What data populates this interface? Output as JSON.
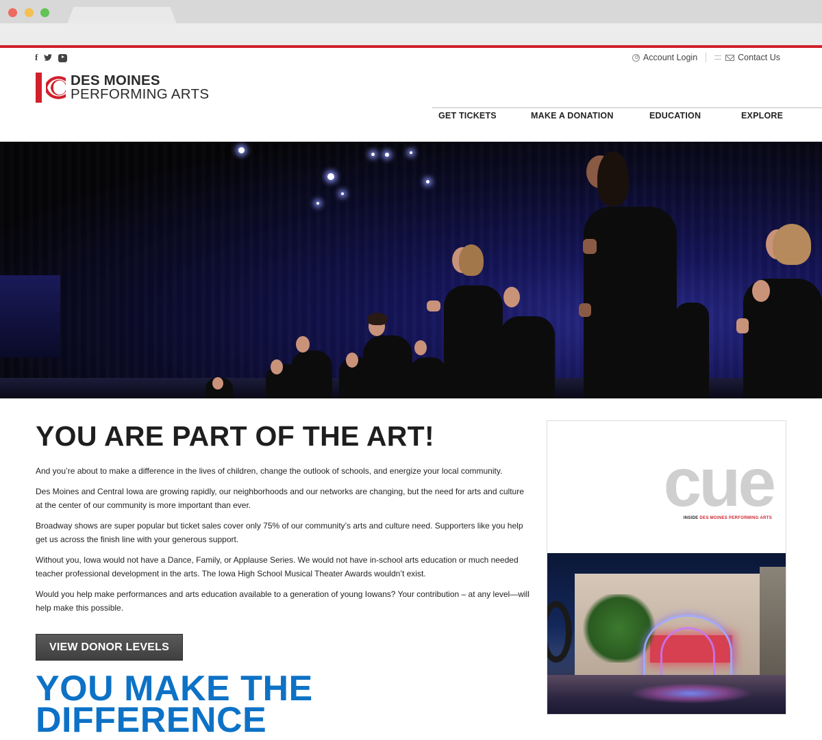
{
  "browser": {
    "tab_title": ""
  },
  "header": {
    "social_icons": [
      "facebook-icon",
      "twitter-icon",
      "youtube-icon"
    ],
    "facebook_glyph": "f",
    "twitter_glyph": "🐦",
    "account_login": "Account Login",
    "contact_us": "Contact Us",
    "logo_line1": "DES MOINES",
    "logo_line2": "PERFORMING ARTS",
    "nav": [
      "GET TICKETS",
      "MAKE A DONATION",
      "EDUCATION",
      "EXPLORE"
    ]
  },
  "main": {
    "headline": "YOU ARE PART OF THE ART!",
    "paragraphs": [
      "And you’re about to make a difference in the lives of children, change the outlook of schools, and energize your local community.",
      "Des Moines and Central Iowa are growing rapidly, our neighborhoods and our networks are changing, but the need for arts and culture at the center of our community is more important than ever.",
      "Broadway shows are super popular but ticket sales cover only 75% of our community’s arts and culture need. Supporters like you help get us across the finish line with your generous support.",
      "Without you, Iowa would not have a Dance, Family, or Applause Series. We would not have in-school arts education or much needed teacher professional development in the arts. The Iowa High School Musical Theater Awards wouldn’t exist.",
      "Would you help make performances and arts education available to a generation of young Iowans? Your contribution – at any level—will help make this possible."
    ],
    "button_label": "VIEW DONOR LEVELS",
    "headline2_line1": "YOU MAKE THE",
    "headline2_line2": "DIFFERENCE"
  },
  "cue": {
    "title": "cue",
    "subtitle_prefix": "INSIDE ",
    "subtitle_brand": "DES MOINES PERFORMING ARTS"
  },
  "colors": {
    "brand_red": "#d0202b",
    "accent_blue": "#0d72c6",
    "button_gray": "#4d4d4d"
  }
}
